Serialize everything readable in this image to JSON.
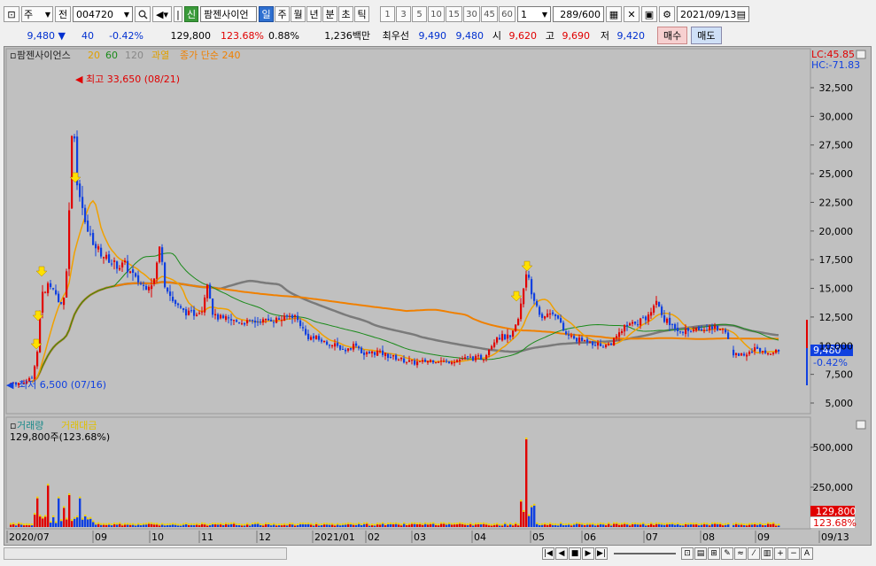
{
  "toolbar": {
    "period_dropdown": "주",
    "market_dropdown": "전",
    "stock_code": "004720",
    "new_badge": "신",
    "stock_name": "팜젠사이언",
    "periods": [
      "일",
      "주",
      "월",
      "년",
      "분",
      "초",
      "틱"
    ],
    "selected_period": "일",
    "intervals": [
      "1",
      "3",
      "5",
      "10",
      "15",
      "30",
      "45",
      "60"
    ],
    "interval_value": "1",
    "count": "289",
    "count_total": "/600",
    "date": "2021/09/13"
  },
  "quote": {
    "price": "9,480",
    "change_arrow": "▼",
    "change": "40",
    "change_pct": "-0.42%",
    "volume": "129,800",
    "volume_ratio": "123.68%",
    "turnover": "0.88%",
    "amount": "1,236백만",
    "best_bid_label": "최우선",
    "best_ask": "9,490",
    "best_bid": "9,480",
    "open_label": "시",
    "open": "9,620",
    "high_label": "고",
    "high": "9,690",
    "low_label": "저",
    "low": "9,420",
    "buy_label": "매수",
    "sell_label": "매도"
  },
  "price_panel": {
    "legend_title": "팜젠사이언스",
    "legend_items": [
      {
        "label": "20",
        "color": "#e0a000"
      },
      {
        "label": "60",
        "color": "#1a8a1a"
      },
      {
        "label": "120",
        "color": "#888888"
      },
      {
        "label": "과열",
        "color": "#e0a000"
      },
      {
        "label": "종가 단순 240",
        "color": "#f08000"
      }
    ],
    "lc": "LC:45.85",
    "hc": "HC:-71.83",
    "max_label": "최고 33,650 (08/21)",
    "min_label": "최저 6,500 (07/16)",
    "current_price": "9,480",
    "current_pct": "-0.42%",
    "y_ticks": [
      "32,500",
      "30,000",
      "27,500",
      "25,000",
      "22,500",
      "20,000",
      "17,500",
      "15,000",
      "12,500",
      "10,000",
      "7,500",
      "5,000"
    ]
  },
  "volume_panel": {
    "legend_volume": "거래량",
    "legend_amount": "거래대금",
    "value_text": "129,800주(123.68%)",
    "y_ticks": [
      "500,000",
      "250,000"
    ],
    "current_volume": "129,800",
    "current_pct": "123.68%"
  },
  "x_axis": {
    "labels": [
      "2020/07",
      "09",
      "10",
      "11",
      "12",
      "2021/01",
      "02",
      "03",
      "04",
      "05",
      "06",
      "07",
      "08",
      "09",
      "09/13"
    ]
  },
  "colors": {
    "up": "#e00000",
    "down": "#1040e0",
    "ma20": "#f0a000",
    "ma60": "#1a8a1a",
    "ma120": "#7a7a7a",
    "ma240": "#f08000",
    "bg": "#c0c0c0"
  },
  "icons": {
    "search": "search-icon",
    "speaker": "speaker-icon",
    "grid": "grid-icon",
    "crosshair": "crosshair-icon",
    "save": "save-icon",
    "settings": "gear-icon",
    "calendar": "calendar-icon"
  }
}
